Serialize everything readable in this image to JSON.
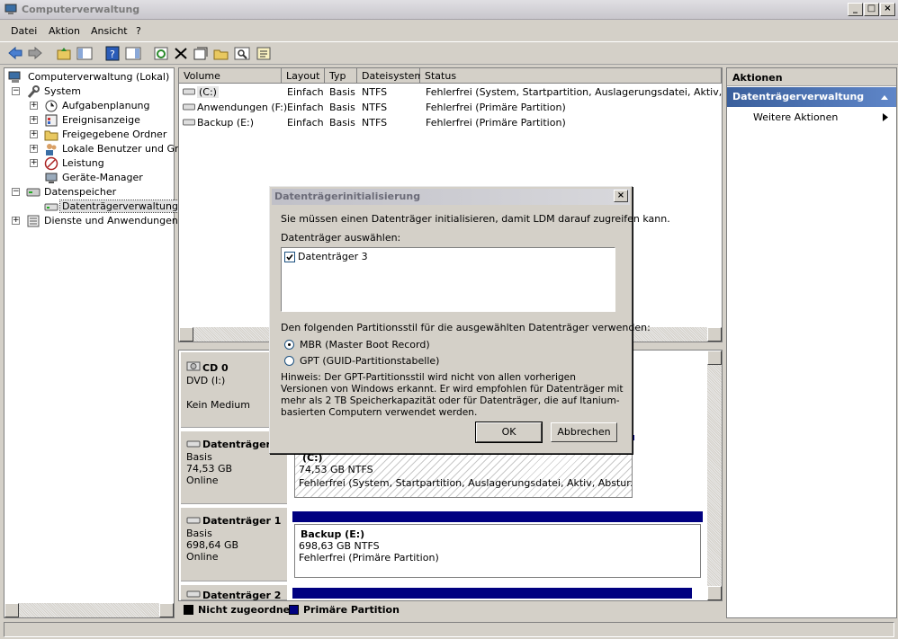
{
  "window": {
    "title": "Computerverwaltung"
  },
  "menu": [
    "Datei",
    "Aktion",
    "Ansicht",
    "?"
  ],
  "tree": {
    "root": "Computerverwaltung (Lokal)",
    "system": "System",
    "system_items": [
      "Aufgabenplanung",
      "Ereignisanzeige",
      "Freigegebene Ordner",
      "Lokale Benutzer und Grupp",
      "Leistung",
      "Geräte-Manager"
    ],
    "storage": "Datenspeicher",
    "disk_mgmt": "Datenträgerverwaltung",
    "services": "Dienste und Anwendungen"
  },
  "volumes": {
    "columns": [
      "Volume",
      "Layout",
      "Typ",
      "Dateisystem",
      "Status"
    ],
    "rows": [
      {
        "volume": "(C:)",
        "layout": "Einfach",
        "type": "Basis",
        "fs": "NTFS",
        "status": "Fehlerfrei (System, Startpartition, Auslagerungsdatei, Aktiv, Absturz"
      },
      {
        "volume": "Anwendungen (F:)",
        "layout": "Einfach",
        "type": "Basis",
        "fs": "NTFS",
        "status": "Fehlerfrei (Primäre Partition)"
      },
      {
        "volume": "Backup (E:)",
        "layout": "Einfach",
        "type": "Basis",
        "fs": "NTFS",
        "status": "Fehlerfrei (Primäre Partition)"
      }
    ]
  },
  "diskmap": {
    "cd": {
      "name": "CD 0",
      "line1": "DVD (I:)",
      "line2": "Kein Medium"
    },
    "disk0": {
      "name": "Datenträger",
      "type": "Basis",
      "size": "74,53 GB",
      "state": "Online",
      "vol_name": "(C:)",
      "vol_size": "74,53 GB NTFS",
      "vol_status": "Fehlerfrei (System, Startpartition, Auslagerungsdatei, Aktiv, Absturzabbild, I"
    },
    "disk1": {
      "name": "Datenträger 1",
      "type": "Basis",
      "size": "698,64 GB",
      "state": "Online",
      "vol_name": "Backup  (E:)",
      "vol_size": "698,63 GB NTFS",
      "vol_status": "Fehlerfrei (Primäre Partition)"
    },
    "disk2": {
      "name": "Datenträger 2"
    }
  },
  "legend": {
    "unallocated": "Nicht zugeordnet",
    "primary": "Primäre Partition",
    "unallocated_color": "#000000",
    "primary_color": "#000080"
  },
  "actions": {
    "header": "Aktionen",
    "section": "Datenträgerverwaltung",
    "more": "Weitere Aktionen"
  },
  "dialog": {
    "title": "Datenträgerinitialisierung",
    "intro": "Sie müssen einen Datenträger initialisieren, damit LDM darauf zugreifen kann.",
    "select_label": "Datenträger auswählen:",
    "disk_item": "Datenträger 3",
    "disk_checked": true,
    "style_label": "Den folgenden Partitionsstil für die ausgewählten Datenträger verwenden:",
    "mbr": "MBR (Master Boot Record)",
    "gpt": "GPT (GUID-Partitionstabelle)",
    "selected_style": "MBR",
    "hint": "Hinweis: Der GPT-Partitionsstil wird nicht von allen vorherigen Versionen von Windows erkannt. Er wird empfohlen für Datenträger mit mehr als 2 TB Speicherkapazität oder für Datenträger, die auf Itanium-basierten Computern verwendet werden.",
    "ok": "OK",
    "cancel": "Abbrechen"
  }
}
